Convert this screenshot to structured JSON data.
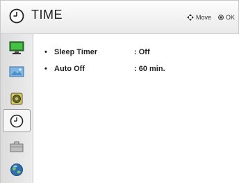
{
  "header": {
    "title": "TIME",
    "hint_move": "Move",
    "hint_ok": "OK"
  },
  "sidebar": {
    "items": [
      {
        "name": "picture",
        "icon": "monitor-icon"
      },
      {
        "name": "screen",
        "icon": "screen-image-icon"
      },
      {
        "name": "audio",
        "icon": "speaker-icon"
      },
      {
        "name": "time",
        "icon": "clock-icon",
        "active": true
      },
      {
        "name": "option",
        "icon": "toolbox-icon"
      },
      {
        "name": "network",
        "icon": "globe-icon"
      }
    ]
  },
  "settings": [
    {
      "bullet": "•",
      "label": "Sleep Timer",
      "value": ": Off"
    },
    {
      "bullet": "•",
      "label": "Auto Off",
      "value": ": 60 min."
    }
  ],
  "colors": {
    "accent_active_border": "#9a9a9a",
    "monitor_green": "#3fa83f",
    "globe_blue": "#2f6fb0"
  }
}
